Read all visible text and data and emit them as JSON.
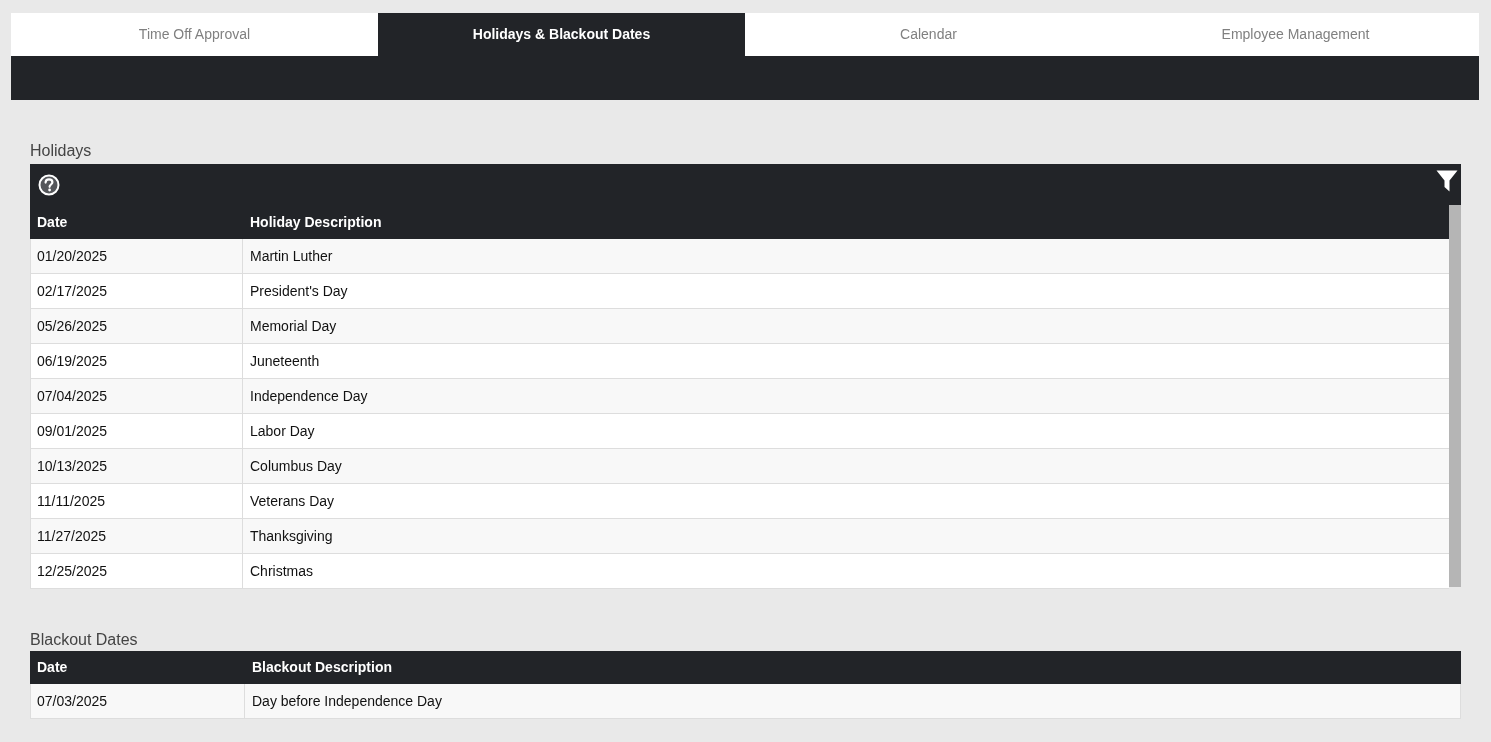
{
  "tabs": [
    {
      "label": "Time Off Approval",
      "selected": false
    },
    {
      "label": "Holidays & Blackout Dates",
      "selected": true
    },
    {
      "label": "Calendar",
      "selected": false
    },
    {
      "label": "Employee Management",
      "selected": false
    }
  ],
  "holidays": {
    "title": "Holidays",
    "columns": [
      "Date",
      "Holiday Description"
    ],
    "rows": [
      [
        "01/20/2025",
        "Martin Luther"
      ],
      [
        "02/17/2025",
        "President's Day"
      ],
      [
        "05/26/2025",
        "Memorial Day"
      ],
      [
        "06/19/2025",
        "Juneteenth"
      ],
      [
        "07/04/2025",
        "Independence Day"
      ],
      [
        "09/01/2025",
        "Labor Day"
      ],
      [
        "10/13/2025",
        "Columbus Day"
      ],
      [
        "11/11/2025",
        "Veterans Day"
      ],
      [
        "11/27/2025",
        "Thanksgiving"
      ],
      [
        "12/25/2025",
        "Christmas"
      ]
    ]
  },
  "blackout_dates": {
    "title": "Blackout Dates",
    "columns": [
      "Date",
      "Blackout Description"
    ],
    "rows": [
      [
        "07/03/2025",
        "Day before Independence Day"
      ]
    ]
  }
}
